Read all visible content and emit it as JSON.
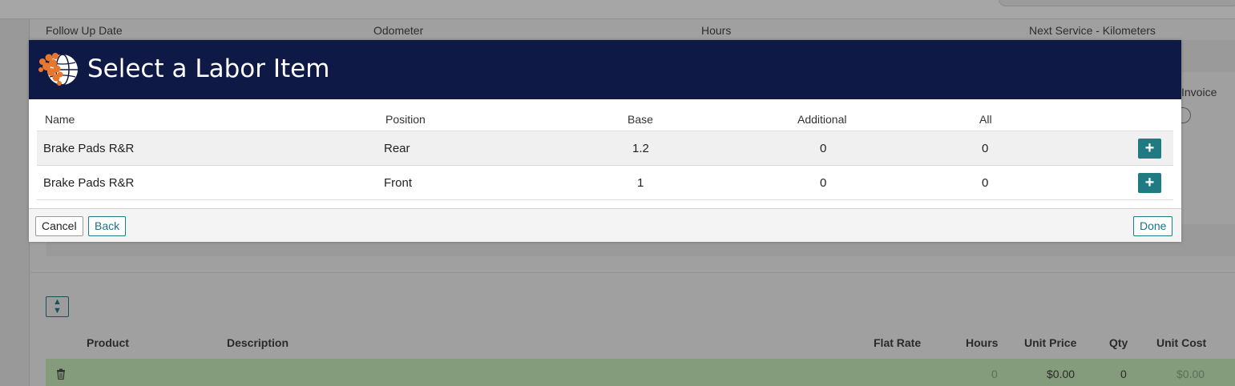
{
  "background": {
    "fields": [
      "Follow Up Date",
      "Odometer",
      "Hours",
      "Next Service - Kilometers"
    ],
    "invoice_label": "Invoice",
    "table_headers": [
      "Product",
      "Description",
      "Flat Rate",
      "Hours",
      "Unit Price",
      "Qty",
      "Unit Cost"
    ],
    "row": {
      "hours": "0",
      "unit_price": "$0.00",
      "qty": "0",
      "unit_cost": "$0.00"
    }
  },
  "modal": {
    "title": "Select a Labor Item",
    "columns": [
      "Name",
      "Position",
      "Base",
      "Additional",
      "All"
    ],
    "rows": [
      {
        "name": "Brake Pads R&R",
        "position": "Rear",
        "base": "1.2",
        "additional": "0",
        "all": "0"
      },
      {
        "name": "Brake Pads R&R",
        "position": "Front",
        "base": "1",
        "additional": "0",
        "all": "0"
      }
    ],
    "add_label": "+",
    "footer": {
      "cancel": "Cancel",
      "back": "Back",
      "done": "Done"
    }
  },
  "colors": {
    "header_bg": "#0e1a45",
    "accent": "#1f7b81",
    "logo_orange": "#e8762d"
  },
  "icons": {
    "logo": "globe-logo-icon",
    "add": "plus-icon",
    "sort": "sort-icon",
    "delete": "trash-icon"
  }
}
